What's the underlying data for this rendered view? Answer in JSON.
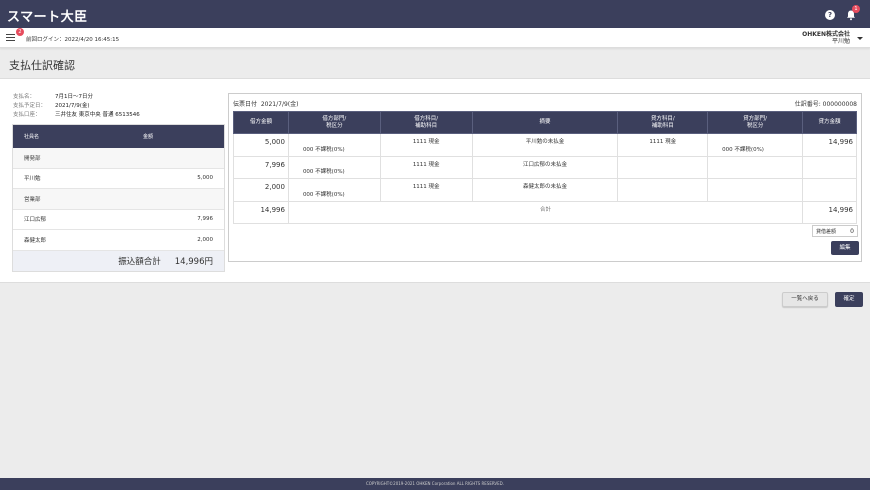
{
  "app": {
    "title": "スマート大臣"
  },
  "header": {
    "help_icon": "?",
    "bell_badge": "1"
  },
  "subbar": {
    "menu_badge": "2",
    "last_login": "前回ログイン：2022/4/20 16:45:15",
    "company": "OHKEN株式会社",
    "user": "平川勉"
  },
  "page": {
    "title": "支払仕訳確認"
  },
  "info": [
    {
      "label": "支払名：",
      "value": "7月1日〜7日分"
    },
    {
      "label": "支払予定日：",
      "value": "2021/7/9(金)"
    },
    {
      "label": "支払口座：",
      "value": "三井住友 東京中央 普通 6513546"
    }
  ],
  "left_table": {
    "col_name": "社員名",
    "col_amount": "金額",
    "rows": [
      {
        "type": "dept",
        "name": "開発部",
        "amount": ""
      },
      {
        "type": "emp",
        "name": "平川勉",
        "amount": "5,000"
      },
      {
        "type": "dept",
        "name": "営業部",
        "amount": ""
      },
      {
        "type": "emp",
        "name": "江口広郁",
        "amount": "7,996"
      },
      {
        "type": "emp",
        "name": "森健太郎",
        "amount": "2,000"
      }
    ],
    "total_label": "振込額合計",
    "total_value": "14,996円"
  },
  "journal": {
    "voucher_date_label": "伝票日付",
    "voucher_date": "2021/7/9(金)",
    "voucher_no": "仕訳番号: 000000008",
    "headers": [
      "借方金額",
      "借方部門/\n税区分",
      "借方科目/\n補助科目",
      "摘要",
      "貸方科目/\n補助科目",
      "貸方部門/\n税区分",
      "貸方金額"
    ],
    "rows": [
      {
        "debit_amount": "5,000",
        "debit_tax": "000 不課税(0%)",
        "debit_account": "1111 現金",
        "summary": "平川勉の未払金",
        "credit_account": "1111 現金",
        "credit_tax": "000 不課税(0%)",
        "credit_amount": "14,996"
      },
      {
        "debit_amount": "7,996",
        "debit_tax": "000 不課税(0%)",
        "debit_account": "1111 現金",
        "summary": "江口広郁の未払金",
        "credit_account": "",
        "credit_tax": "",
        "credit_amount": ""
      },
      {
        "debit_amount": "2,000",
        "debit_tax": "000 不課税(0%)",
        "debit_account": "1111 現金",
        "summary": "森健太郎の未払金",
        "credit_account": "",
        "credit_tax": "",
        "credit_amount": ""
      }
    ],
    "total_debit": "14,996",
    "total_label": "合計",
    "total_credit": "14,996",
    "diff_label": "貸借差額",
    "diff_value": "0",
    "edit_label": "編集"
  },
  "actions": {
    "back": "一覧へ戻る",
    "confirm": "確定"
  },
  "footer": {
    "text": "COPYRIGHT©2019-2021 OHKEN Corporation ALL RIGHTS RESERVED."
  }
}
